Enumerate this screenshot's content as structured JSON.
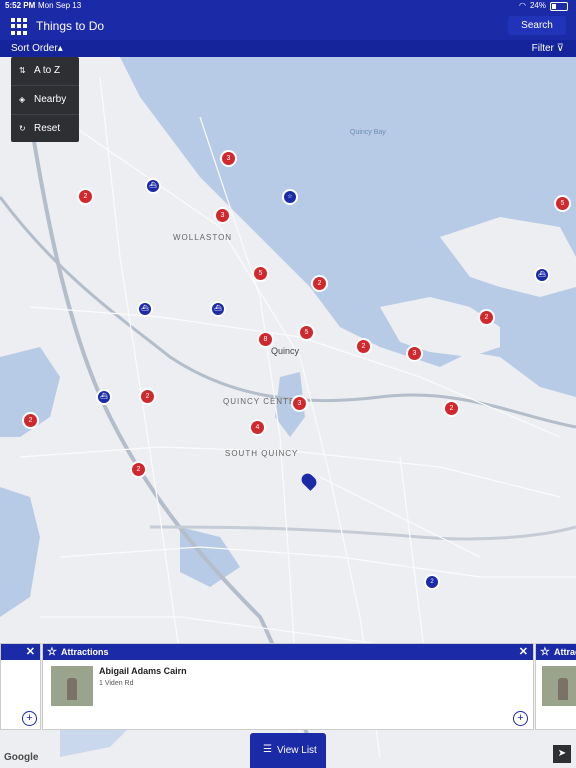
{
  "status_bar": {
    "time": "5:52 PM",
    "date": "Mon Sep 13",
    "battery": "24%"
  },
  "header": {
    "title": "Things to Do",
    "search_label": "Search"
  },
  "subbar": {
    "sort_label": "Sort Order",
    "filter_label": "Filter"
  },
  "sort_menu": {
    "items": [
      {
        "label": "A to Z",
        "icon": "sort-icon"
      },
      {
        "label": "Nearby",
        "icon": "location-icon"
      },
      {
        "label": "Reset",
        "icon": "reset-icon"
      }
    ]
  },
  "map": {
    "labels": {
      "wollaston": "WOLLASTON",
      "quincy": "Quincy",
      "quincy_center": "QUINCY CENTER",
      "south_quincy": "SOUTH QUINCY",
      "quincy_bay": "Quincy Bay"
    },
    "red_markers": [
      "3",
      "2",
      "3",
      "5",
      "2",
      "5",
      "8",
      "2",
      "3",
      "2",
      "2",
      "3",
      "4",
      "2",
      "2",
      "5",
      "2"
    ],
    "blue_marker_count": "2"
  },
  "cards": [
    {
      "category": "Attractions",
      "title": "",
      "address": ""
    },
    {
      "category": "Attractions",
      "title": "Abigail Adams Cairn",
      "address": "1 Viden Rd"
    },
    {
      "category": "Attrac",
      "title": "",
      "address": ""
    }
  ],
  "bottom": {
    "view_list_label": "View List",
    "google_label": "Google"
  },
  "colors": {
    "brand": "#1b2aa6",
    "marker_red": "#d0282c",
    "water": "#b8cbe6",
    "land": "#eceef1"
  }
}
